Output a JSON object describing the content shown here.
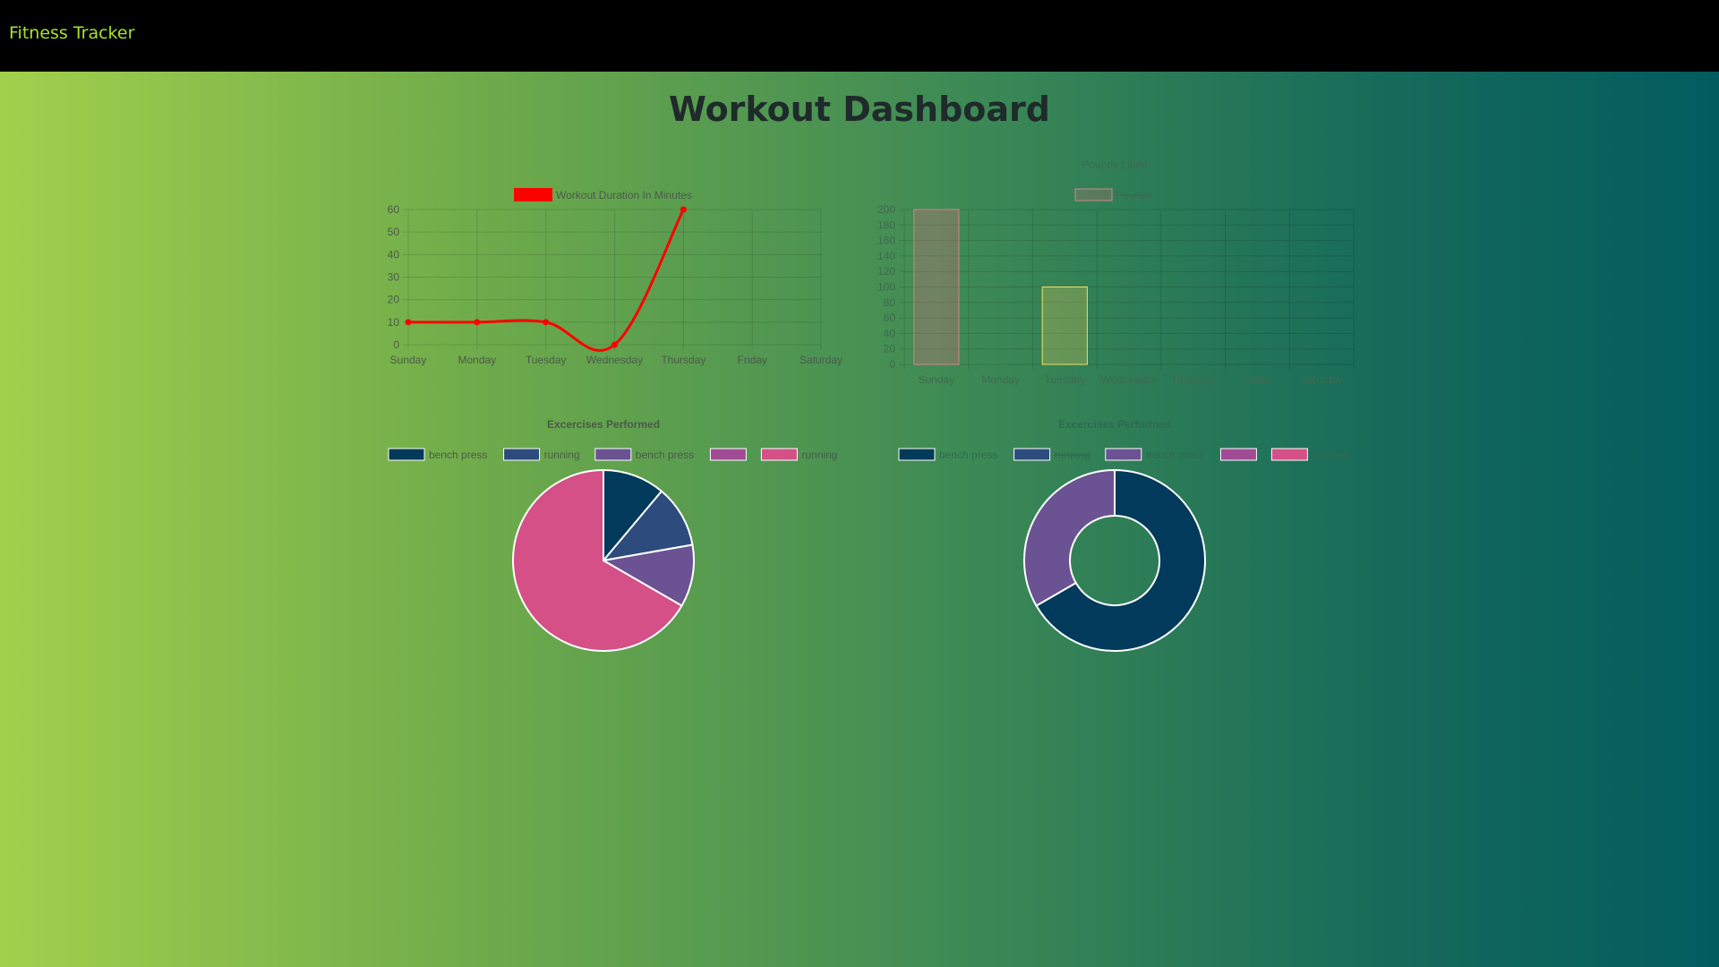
{
  "navbar": {
    "brand": "Fitness Tracker"
  },
  "page": {
    "title": "Workout Dashboard"
  },
  "colors": {
    "navy": "#013a5a",
    "blue": "#2d4b7d",
    "purple": "#6a5293",
    "magenta": "#a14b95",
    "pink": "#d45087",
    "line": "#ff0000"
  },
  "chart_data": [
    {
      "type": "line",
      "title": "",
      "legend": [
        "Workout Duration In Minutes"
      ],
      "categories": [
        "Sunday",
        "Monday",
        "Tuesday",
        "Wednesday",
        "Thursday",
        "Friday",
        "Saturday"
      ],
      "y_ticks": [
        "0",
        "10",
        "20",
        "30",
        "40",
        "50",
        "60"
      ],
      "ylim": [
        0,
        60
      ],
      "grid": true,
      "series": [
        {
          "name": "Workout Duration In Minutes",
          "values": [
            10,
            10,
            10,
            0,
            60,
            null,
            null
          ]
        }
      ]
    },
    {
      "type": "bar",
      "title": "Pounds Lifted",
      "legend": [
        "Pounds"
      ],
      "categories": [
        "Sunday",
        "Monday",
        "Tuesday",
        "Wednesday",
        "Thursday",
        "Friday",
        "Saturday"
      ],
      "y_ticks": [
        "0",
        "20",
        "40",
        "60",
        "80",
        "100",
        "120",
        "140",
        "160",
        "180",
        "200"
      ],
      "ylim": [
        0,
        200
      ],
      "grid": true,
      "series": [
        {
          "name": "Pounds",
          "values": [
            200,
            0,
            100,
            0,
            0,
            0,
            0
          ]
        }
      ]
    },
    {
      "type": "pie",
      "title": "Excercises Performed",
      "legend": [
        "bench press",
        "running",
        "bench press",
        "",
        "running"
      ],
      "values": [
        10,
        10,
        10,
        0,
        60
      ]
    },
    {
      "type": "pie",
      "title": "Excercises Performed",
      "legend": [
        "bench press",
        "running",
        "bench press",
        "",
        "running"
      ],
      "legend_struck": [
        false,
        true,
        false,
        false,
        true
      ],
      "values": [
        200,
        0,
        100,
        0,
        0
      ]
    }
  ]
}
